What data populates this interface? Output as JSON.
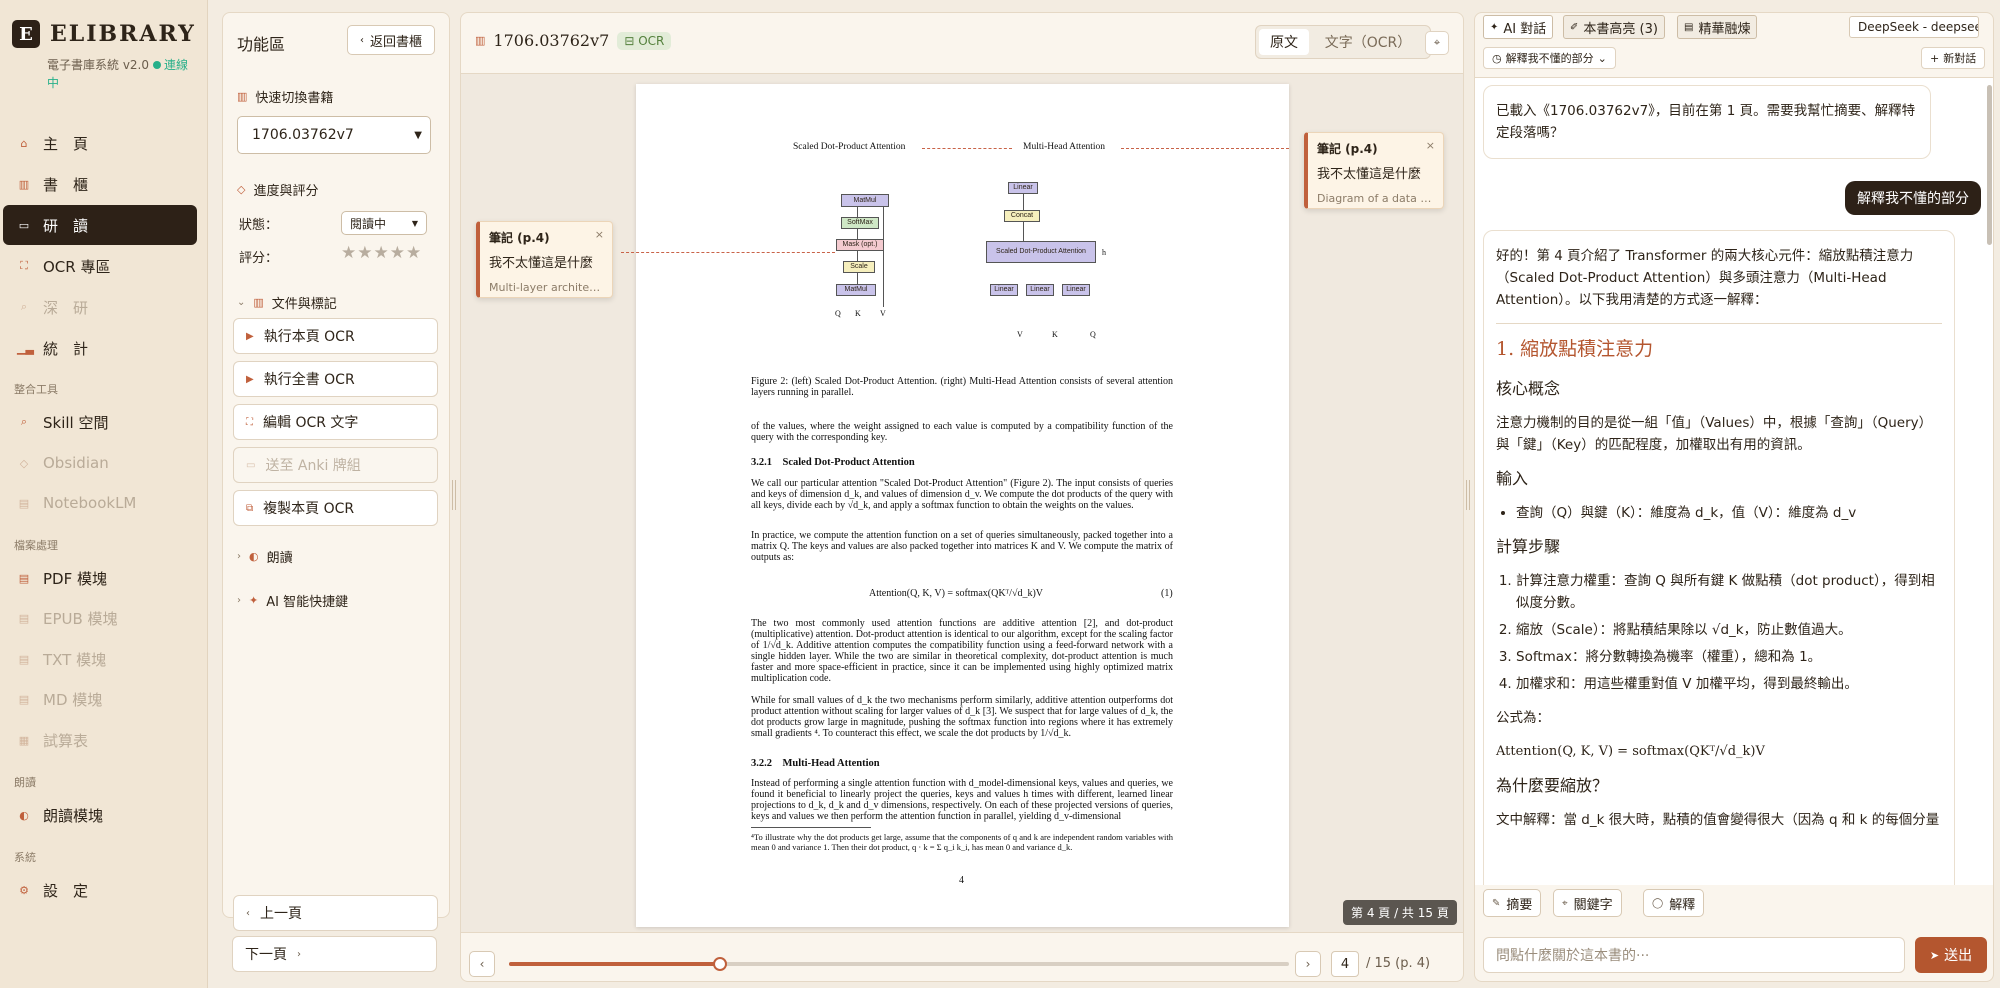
{
  "app": {
    "logo_letter": "E",
    "name": "ELIBRARY",
    "subtitle": "電子書庫系統 v2.0",
    "status": "連線中"
  },
  "nav": {
    "items": [
      {
        "label": "主　頁",
        "icon": "home-icon"
      },
      {
        "label": "書　櫃",
        "icon": "book-icon"
      },
      {
        "label": "研　讀",
        "icon": "reading-icon"
      },
      {
        "label": "OCR 專區",
        "icon": "scan-icon"
      },
      {
        "label": "深　研",
        "icon": "search-icon"
      },
      {
        "label": "統　計",
        "icon": "chart-icon"
      },
      {
        "label": "Skill 空間",
        "icon": "skill-icon"
      },
      {
        "label": "Obsidian",
        "icon": "obsidian-icon"
      },
      {
        "label": "NotebookLM",
        "icon": "notebook-icon"
      },
      {
        "label": "PDF 模塊",
        "icon": "pdf-icon"
      },
      {
        "label": "EPUB 模塊",
        "icon": "epub-icon"
      },
      {
        "label": "TXT 模塊",
        "icon": "txt-icon"
      },
      {
        "label": "MD 模塊",
        "icon": "md-icon"
      },
      {
        "label": "試算表",
        "icon": "sheet-icon"
      },
      {
        "label": "朗讀模塊",
        "icon": "speaker-icon"
      },
      {
        "label": "設　定",
        "icon": "gear-icon"
      }
    ],
    "sections": [
      "整合工具",
      "檔案處理",
      "朗讀",
      "系統"
    ]
  },
  "panel": {
    "title": "功能區",
    "back_label": "返回書櫃",
    "switch_label": "快速切換書籍",
    "book_select": "1706.03762v7",
    "progress_label": "進度與評分",
    "status_label": "狀態：",
    "status_value": "閱讀中",
    "rating_label": "評分：",
    "rating_stars": "★★★★★",
    "docs_label": "文件與標記",
    "buttons": [
      "執行本頁 OCR",
      "執行全書 OCR",
      "編輯 OCR 文字",
      "送至 Anki 牌組",
      "複製本頁 OCR"
    ],
    "read_aloud": "朗讀",
    "ai_shortcuts": "AI 智能快捷鍵",
    "prev_page": "上一頁",
    "next_page": "下一頁"
  },
  "reader": {
    "title": "1706.03762v7",
    "ocr_tag": "OCR",
    "view_original": "原文",
    "view_text": "文字（OCR）",
    "page_badge": "第 4 頁 / 共 15 頁",
    "page_input": "4",
    "page_total": "/ 15 (p. 4)",
    "progress": 0.27,
    "notes": [
      {
        "title": "筆記 (p.4)",
        "question": "我不太懂這是什麼",
        "desc": "Multi-layer architect···"
      },
      {
        "title": "筆記 (p.4)",
        "question": "我不太懂這是什麼",
        "desc": "Diagram of a data pr···"
      }
    ]
  },
  "paper": {
    "fig_left_title": "Scaled Dot-Product Attention",
    "fig_right_title": "Multi-Head Attention",
    "left_boxes": [
      "MatMul",
      "SoftMax",
      "Mask (opt.)",
      "Scale",
      "MatMul"
    ],
    "left_inputs": [
      "Q",
      "K",
      "V"
    ],
    "right_boxes": [
      "Linear",
      "Concat",
      "Scaled Dot-Product Attention",
      "Linear",
      "Linear",
      "Linear"
    ],
    "right_inputs": [
      "V",
      "K",
      "Q"
    ],
    "head_label": "h",
    "caption": "Figure 2: (left) Scaled Dot-Product Attention. (right) Multi-Head Attention consists of several attention layers running in parallel.",
    "p1": "of the values, where the weight assigned to each value is computed by a compatibility function of the query with the corresponding key.",
    "s321": "3.2.1　Scaled Dot-Product Attention",
    "p2": "We call our particular attention \"Scaled Dot-Product Attention\" (Figure 2). The input consists of queries and keys of dimension d_k, and values of dimension d_v. We compute the dot products of the query with all keys, divide each by √d_k, and apply a softmax function to obtain the weights on the values.",
    "p3": "In practice, we compute the attention function on a set of queries simultaneously, packed together into a matrix Q. The keys and values are also packed together into matrices K and V. We compute the matrix of outputs as:",
    "eq": "Attention(Q, K, V) = softmax(QKᵀ/√d_k)V",
    "eq_no": "(1)",
    "p4": "The two most commonly used attention functions are additive attention [2], and dot-product (multiplicative) attention. Dot-product attention is identical to our algorithm, except for the scaling factor of 1/√d_k. Additive attention computes the compatibility function using a feed-forward network with a single hidden layer. While the two are similar in theoretical complexity, dot-product attention is much faster and more space-efficient in practice, since it can be implemented using highly optimized matrix multiplication code.",
    "p5": "While for small values of d_k the two mechanisms perform similarly, additive attention outperforms dot product attention without scaling for larger values of d_k [3]. We suspect that for large values of d_k, the dot products grow large in magnitude, pushing the softmax function into regions where it has extremely small gradients ⁴. To counteract this effect, we scale the dot products by 1/√d_k.",
    "s322": "3.2.2　Multi-Head Attention",
    "p6": "Instead of performing a single attention function with d_model-dimensional keys, values and queries, we found it beneficial to linearly project the queries, keys and values h times with different, learned linear projections to d_k, d_k and d_v dimensions, respectively. On each of these projected versions of queries, keys and values we then perform the attention function in parallel, yielding d_v-dimensional",
    "footnote": "⁴To illustrate why the dot products get large, assume that the components of q and k are independent random variables with mean 0 and variance 1. Then their dot product, q · k = Σ q_i k_i, has mean 0 and variance d_k.",
    "page_no": "4"
  },
  "ai": {
    "tabs": [
      "AI 對話",
      "本書高亮 (3)",
      "精華融煉"
    ],
    "model": "DeepSeek - deepseek-chat",
    "context_chip": "解釋我不懂的部分",
    "new_chat": "新對話",
    "msg1": "已載入《1706.03762v7》，目前在第 1 頁。需要我幫忙摘要、解釋特定段落嗎？",
    "msg_user": "解釋我不懂的部分",
    "reply_intro": "好的！第 4 頁介紹了 Transformer 的兩大核心元件：縮放點積注意力（Scaled Dot-Product Attention）與多頭注意力（Multi-Head Attention）。以下我用清楚的方式逐一解釋：",
    "h_section": "1. 縮放點積注意力",
    "h_core": "核心概念",
    "core_text": "注意力機制的目的是從一組「值」（Values）中，根據「查詢」（Query）與「鍵」（Key）的匹配程度，加權取出有用的資訊。",
    "h_input": "輸入",
    "input_item": "查詢（Q）與鍵（K）：維度為 d_k，值（V）：維度為 d_v",
    "h_steps": "計算步驟",
    "steps": [
      "計算注意力權重：查詢 Q 與所有鍵 K 做點積（dot product），得到相似度分數。",
      "縮放（Scale）：將點積結果除以 √d_k，防止數值過大。",
      "Softmax：將分數轉換為機率（權重），總和為 1。",
      "加權求和：用這些權重對值 V 加權平均，得到最終輸出。"
    ],
    "formula_label": "公式為：",
    "formula": "Attention(Q, K, V) = softmax(QKᵀ/√d_k)V",
    "h_why": "為什麼要縮放？",
    "why_text": "文中解釋：當 d_k 很大時，點積的值會變得很大（因為 q 和 k 的每個分量",
    "quick": [
      "摘要",
      "關鍵字",
      "解釋"
    ],
    "input_placeholder": "問點什麼關於這本書的···",
    "send_label": "送出"
  }
}
